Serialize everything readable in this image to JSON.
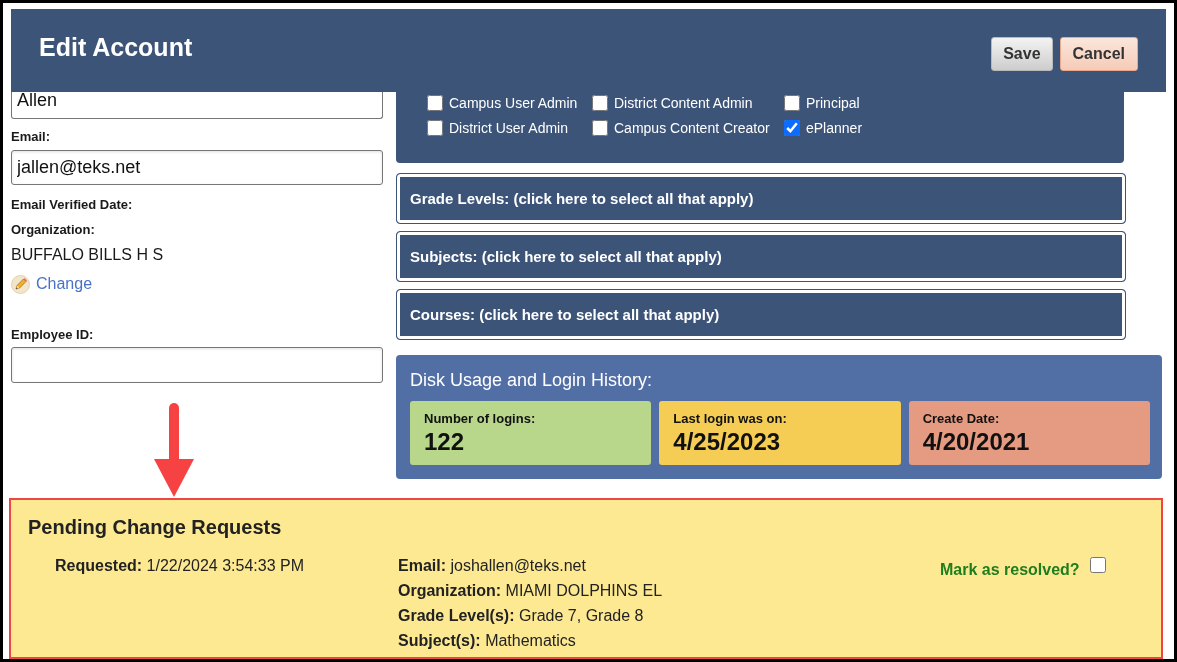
{
  "header": {
    "title": "Edit Account",
    "buttons": [
      {
        "label": "Save",
        "kind": "save"
      },
      {
        "label": "Cancel",
        "kind": "cancel"
      }
    ]
  },
  "account_form": {
    "field_1": {
      "value": "Allen"
    },
    "email": {
      "label": "Email:",
      "value": "jallen@teks.net"
    },
    "email_verified_date": {
      "label": "Email Verified Date:"
    },
    "organization": {
      "label": "Organization:",
      "value": "BUFFALO BILLS H S",
      "change_link": "Change"
    },
    "employee_id": {
      "label": "Employee ID:"
    }
  },
  "roles": [
    {
      "label": "Campus User Admin",
      "checked": false
    },
    {
      "label": "District Content Admin",
      "checked": false
    },
    {
      "label": "Principal",
      "checked": false
    },
    {
      "label": "District User Admin",
      "checked": false
    },
    {
      "label": "Campus Content Creator",
      "checked": false
    },
    {
      "label": "ePlanner",
      "checked": true
    }
  ],
  "selectors": [
    "Grade Levels: (click here to select all that apply)",
    "Subjects: (click here to select all that apply)",
    "Courses: (click here to select all that apply)"
  ],
  "disk_usage": {
    "title": "Disk Usage and Login History:",
    "stats": [
      {
        "label": "Number of logins:",
        "value": "122",
        "color": "#b8d78b"
      },
      {
        "label": "Last login was on:",
        "value": "4/25/2023",
        "color": "#f5cd55"
      },
      {
        "label": "Create Date:",
        "value": "4/20/2021",
        "color": "#e49b82"
      }
    ]
  },
  "pending_requests": {
    "title": "Pending Change Requests",
    "requested": {
      "label": "Requested:",
      "value": "1/22/2024 3:54:33 PM"
    },
    "changes": [
      {
        "label": "Email:",
        "value": "joshallen@teks.net"
      },
      {
        "label": "Organization:",
        "value": "MIAMI DOLPHINS EL"
      },
      {
        "label": "Grade Level(s):",
        "value": "Grade 7, Grade 8"
      },
      {
        "label": "Subject(s):",
        "value": "Mathematics"
      }
    ],
    "resolve": {
      "label": "Mark as resolved?",
      "checked": false
    }
  }
}
